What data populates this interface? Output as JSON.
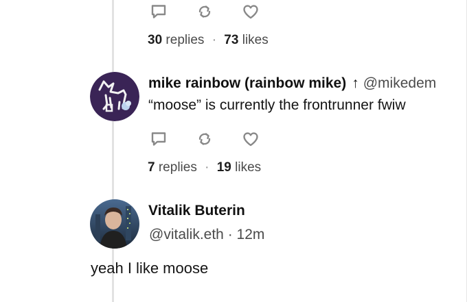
{
  "posts": [
    {
      "stats": {
        "replies_count": "30",
        "replies_label": "replies",
        "separator": "·",
        "likes_count": "73",
        "likes_label": "likes"
      }
    },
    {
      "author": "mike rainbow (rainbow mike)",
      "arrow": "↑",
      "handle": "@mikedem",
      "text": "“moose” is currently the frontrunner fwiw",
      "stats": {
        "replies_count": "7",
        "replies_label": "replies",
        "separator": "·",
        "likes_count": "19",
        "likes_label": "likes"
      }
    },
    {
      "author": "Vitalik Buterin",
      "handle": "@vitalik.eth",
      "separator": "·",
      "time": "12m",
      "text": "yeah I like moose"
    }
  ],
  "icons": [
    "comment-icon",
    "repost-icon",
    "heart-icon"
  ],
  "colors": {
    "thread_line": "#e2e2e2",
    "icon": "#888888",
    "avatar_purple": "#3a2456"
  }
}
